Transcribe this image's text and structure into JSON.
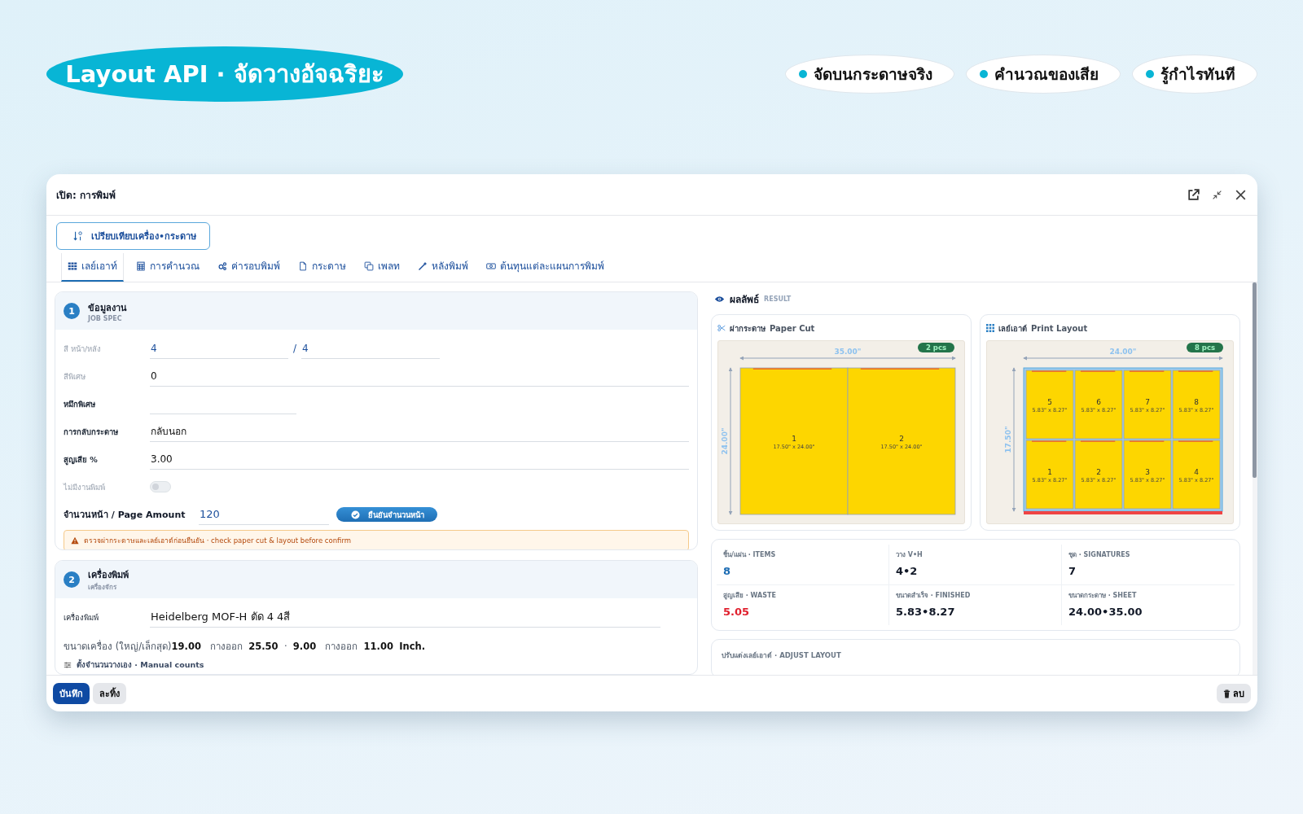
{
  "banner": {
    "title": "Layout API · จัดวางอัจฉริยะ",
    "features": [
      "จัดบนกระดาษจริง",
      "คำนวณของเสีย",
      "รู้กำไรทันที"
    ]
  },
  "window": {
    "title": "เปิด: การพิมพ์"
  },
  "compare_button": "เปรียบเทียบเครื่อง•กระดาษ",
  "tabs": [
    {
      "label": "เลย์เอาท์",
      "selected": true
    },
    {
      "label": "การคำนวณ",
      "selected": false
    },
    {
      "label": "ค่ารอบพิมพ์",
      "selected": false
    },
    {
      "label": "กระดาษ",
      "selected": false
    },
    {
      "label": "เพลท",
      "selected": false
    },
    {
      "label": "หลังพิมพ์",
      "selected": false
    },
    {
      "label": "ต้นทุนแต่ละแผนการพิมพ์",
      "selected": false
    }
  ],
  "job_spec": {
    "number": "1",
    "title": "ข้อมูลงาน",
    "subtitle": "JOB SPEC",
    "fields": [
      {
        "kind": "pair",
        "label": "สี หน้า/หลัง",
        "bold": false,
        "value": "4",
        "separator": "/",
        "value_2": "4"
      },
      {
        "kind": "text",
        "label": "สีพิเศษ",
        "bold": false,
        "value": "0"
      },
      {
        "kind": "short",
        "label": "หมึกพิเศษ",
        "bold": true
      },
      {
        "kind": "text",
        "label": "การกลับกระดาษ",
        "bold": true,
        "value": "กลับนอก"
      },
      {
        "kind": "text",
        "label": "สูญเสีย %",
        "bold": true,
        "value": "3.00"
      },
      {
        "kind": "toggle",
        "label": "ไม่มีงานพิมพ์",
        "bold": false,
        "on": false
      }
    ],
    "page_amount": {
      "label": "จำนวนหน้า / Page Amount",
      "value": "120",
      "button": "ยืนยันจำนวนหน้า"
    },
    "warning": "ตรวจผ่ากระดาษและเลย์เอาต์ก่อนยืนยัน · check paper cut & layout before confirm"
  },
  "machine": {
    "number": "2",
    "title": "เครื่องพิมพ์",
    "subtitle": "เครื่องจักร",
    "fields": [
      {
        "kind": "text",
        "label": "เครื่องพิมพ์",
        "bold": false,
        "value": "Heidelberg MOF-H ตัด 4 4สี"
      }
    ],
    "size_line": "ขนาดเครื่อง (ใหญ่/เล็กสุด)**19.00**   กางออก  **25.50**  ·  **9.00**   กางออก  **11.00**  **Inch.**",
    "manual_link": "ตั้งจำนวนวางเอง · Manual counts"
  },
  "result": {
    "title": "ผลลัพธ์",
    "subtitle": "RESULT",
    "diagrams": [
      {
        "kind": "cut",
        "title": "ผ่ากระดาษ",
        "title_en": "Paper Cut",
        "badge": "2 pcs",
        "width_label": "35.00\"",
        "height_label": "24.00\"",
        "piece_rows": [
          [
            {
              "number": "1",
              "size": "17.50\" x 24.00\""
            },
            {
              "number": "2",
              "size": "17.50\" x 24.00\""
            }
          ]
        ]
      },
      {
        "kind": "layout",
        "title": "เลย์เอาต์",
        "title_en": "Print Layout",
        "badge": "8 pcs",
        "width_label": "24.00\"",
        "height_label": "17.50\"",
        "piece_rows": [
          [
            {
              "number": "5",
              "size": "5.83\" x 8.27\""
            },
            {
              "number": "6",
              "size": "5.83\" x 8.27\""
            },
            {
              "number": "7",
              "size": "5.83\" x 8.27\""
            },
            {
              "number": "8",
              "size": "5.83\" x 8.27\""
            }
          ],
          [
            {
              "number": "1",
              "size": "5.83\" x 8.27\""
            },
            {
              "number": "2",
              "size": "5.83\" x 8.27\""
            },
            {
              "number": "3",
              "size": "5.83\" x 8.27\""
            },
            {
              "number": "4",
              "size": "5.83\" x 8.27\""
            }
          ]
        ]
      }
    ],
    "stats": [
      {
        "label": "ชิ้น/แผ่น · ITEMS",
        "value": "8",
        "color": "#1c6cb3"
      },
      {
        "label": "วาง V•H",
        "value": "4•2",
        "color": "#111827"
      },
      {
        "label": "ชุด · SIGNATURES",
        "value": "7",
        "color": "#111827"
      },
      {
        "label": "สูญเสีย · WASTE",
        "value": "5.05",
        "color": "#e0202e"
      },
      {
        "label": "ขนาดสำเร็จ · FINISHED",
        "value": "5.83•8.27",
        "color": "#111827"
      },
      {
        "label": "ขนาดกระดาษ · SHEET",
        "value": "24.00•35.00",
        "color": "#111827"
      }
    ],
    "adjust_title": "ปรับแต่งเลย์เอาต์ · ADJUST LAYOUT"
  },
  "footer": {
    "save": "บันทึก",
    "discard": "ละทิ้ง",
    "delete": "ลบ"
  }
}
